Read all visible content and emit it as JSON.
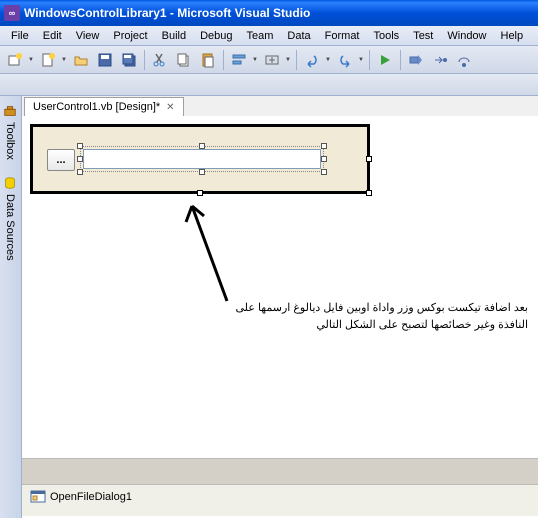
{
  "titlebar": {
    "text": "WindowsControlLibrary1 - Microsoft Visual Studio"
  },
  "menu": {
    "file": "File",
    "edit": "Edit",
    "view": "View",
    "project": "Project",
    "build": "Build",
    "debug": "Debug",
    "team": "Team",
    "data": "Data",
    "format": "Format",
    "tools": "Tools",
    "test": "Test",
    "window": "Window",
    "help": "Help"
  },
  "sidetabs": {
    "toolbox": "Toolbox",
    "datasources": "Data Sources"
  },
  "filetab": {
    "label": "UserControl1.vb [Design]*"
  },
  "designer": {
    "button_label": "..."
  },
  "annotation": {
    "line1": "بعد اضافة تيكست بوكس وزر واداة اوبين فايل ديالوغ ارسمها على",
    "line2": "النافذة وغير خصائصها لتصبح على الشكل التالي"
  },
  "tray": {
    "ofd": "OpenFileDialog1"
  }
}
